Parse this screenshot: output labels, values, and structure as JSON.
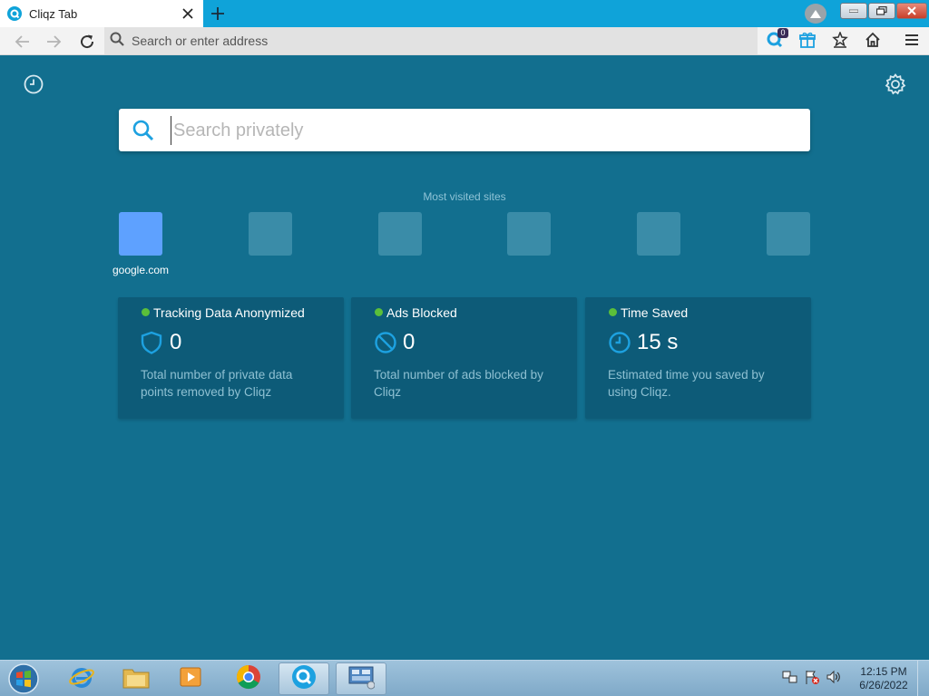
{
  "browser": {
    "tab_title": "Cliqz Tab",
    "address_placeholder": "Search or enter address",
    "notification_count": "0"
  },
  "page": {
    "search_placeholder": "Search privately",
    "most_visited_title": "Most visited sites",
    "tiles": [
      {
        "label": "google.com"
      },
      {
        "label": ""
      },
      {
        "label": ""
      },
      {
        "label": ""
      },
      {
        "label": ""
      },
      {
        "label": ""
      }
    ],
    "stats": [
      {
        "title": "Tracking Data Anonymized",
        "value": "0",
        "description": "Total number of private data points removed by Cliqz",
        "icon": "shield-icon"
      },
      {
        "title": "Ads Blocked",
        "value": "0",
        "description": "Total number of ads blocked by Cliqz",
        "icon": "blocked-icon"
      },
      {
        "title": "Time Saved",
        "value": "15 s",
        "description": "Estimated time you saved by using Cliqz.",
        "icon": "clock-icon"
      }
    ]
  },
  "taskbar": {
    "time": "12:15 PM",
    "date": "6/26/2022"
  },
  "colors": {
    "page_background": "#126f8f",
    "titlebar": "#0fa3d9",
    "card_background": "#0d5b78",
    "status_dot": "#5bbf3a",
    "active_tile": "#5ea1ff",
    "accent_icon": "#1da1e0"
  }
}
